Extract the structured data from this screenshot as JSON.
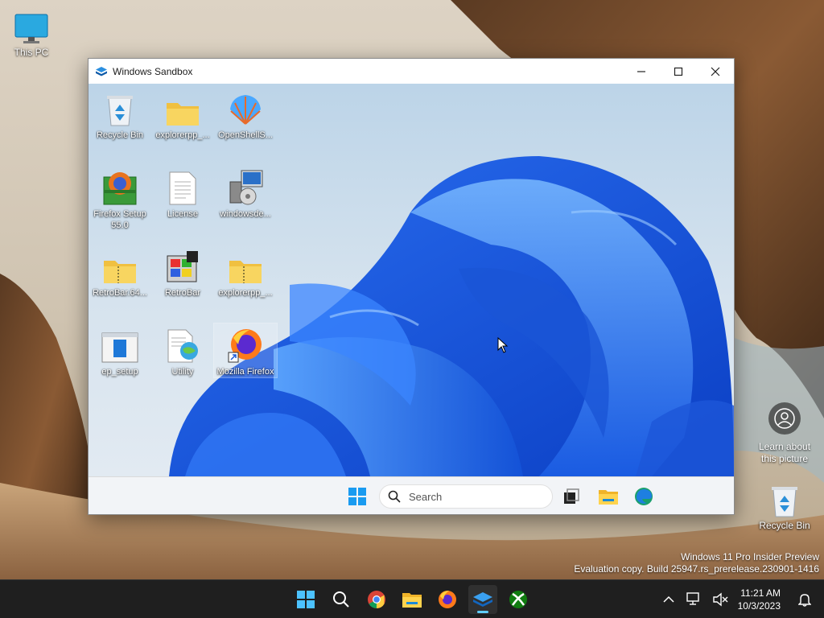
{
  "desktop": {
    "icons": [
      {
        "label": "This PC",
        "icon": "this-pc-icon"
      },
      {
        "label": "Recycle Bin",
        "icon": "recycle-bin-icon"
      }
    ],
    "learn_about": "Learn about this picture",
    "watermark": {
      "line1": "Windows 11 Pro Insider Preview",
      "line2": "Evaluation copy. Build 25947.rs_prerelease.230901-1416"
    }
  },
  "sandbox": {
    "title": "Windows Sandbox",
    "buttons": {
      "minimize": "minimize-icon",
      "maximize": "maximize-icon",
      "close": "close-icon"
    },
    "icons": [
      {
        "label": "Recycle Bin",
        "icon": "recycle-bin-icon"
      },
      {
        "label": "explorerpp_...",
        "icon": "folder-icon"
      },
      {
        "label": "OpenShellS...",
        "icon": "shell-icon"
      },
      {
        "label": "Firefox Setup 55.0",
        "icon": "firefox-setup-icon"
      },
      {
        "label": "License",
        "icon": "document-icon"
      },
      {
        "label": "windowsde...",
        "icon": "installer-icon"
      },
      {
        "label": "RetroBar.64...",
        "icon": "zip-folder-icon"
      },
      {
        "label": "RetroBar",
        "icon": "retrobar-icon"
      },
      {
        "label": "explorerpp_...",
        "icon": "zip-folder-icon"
      },
      {
        "label": "ep_setup",
        "icon": "ep-setup-icon"
      },
      {
        "label": "Utility",
        "icon": "utility-icon"
      },
      {
        "label": "Mozilla Firefox",
        "icon": "firefox-shortcut-icon"
      }
    ],
    "taskbar": {
      "search_placeholder": "Search"
    }
  },
  "taskbar": {
    "apps": [
      "start",
      "search",
      "chrome",
      "file-explorer",
      "firefox",
      "windows-sandbox",
      "xbox"
    ],
    "active_app": "windows-sandbox",
    "time": "11:21 AM",
    "date": "10/3/2023"
  }
}
